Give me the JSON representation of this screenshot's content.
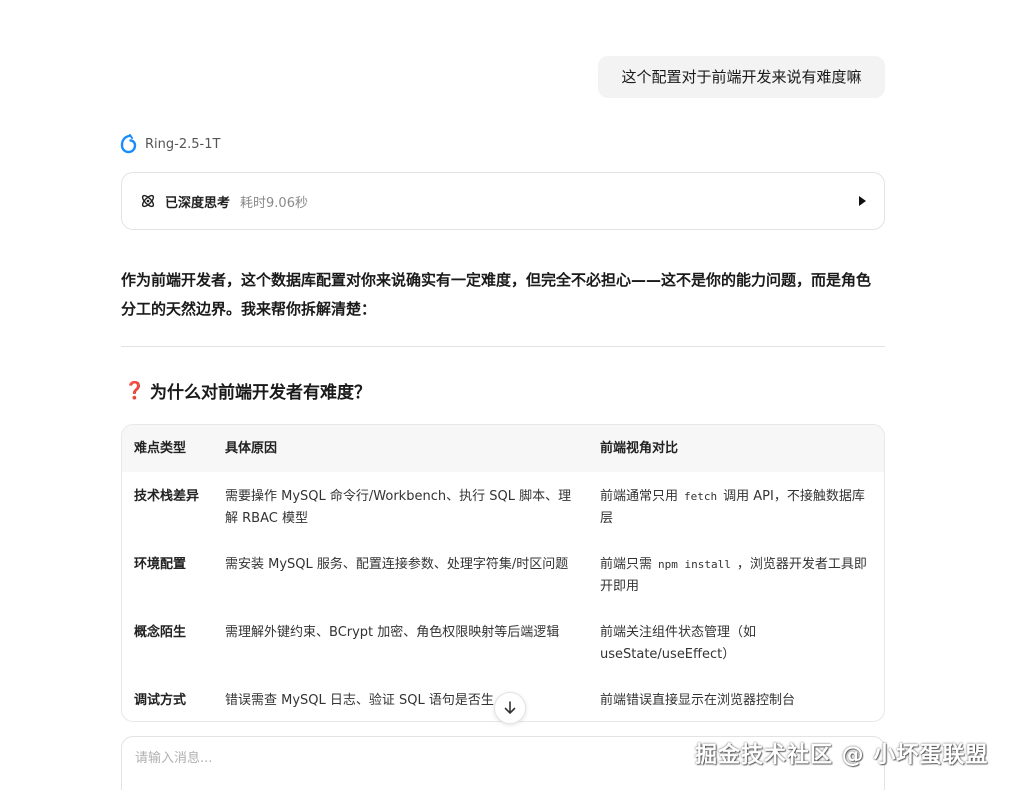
{
  "user_message": "这个配置对于前端开发来说有难度嘛",
  "model": {
    "name": "Ring-2.5-1T",
    "logo_icon": "ring-logo-icon"
  },
  "thinking": {
    "label": "已深度思考",
    "time": "耗时9.06秒"
  },
  "answer": {
    "intro": "作为前端开发者，这个数据库配置对你来说确实有一定难度，但完全不必担心——这不是你的能力问题，而是角色分工的天然边界。我来帮你拆解清楚：",
    "section_title": "为什么对前端开发者有难度？",
    "section_icon": "❓",
    "table": {
      "headers": [
        "难点类型",
        "具体原因",
        "前端视角对比"
      ],
      "rows": [
        {
          "type": "技术栈差异",
          "reason": "需要操作 MySQL 命令行/Workbench、执行 SQL 脚本、理解 RBAC 模型",
          "front_a": "前端通常只用",
          "front_code": "fetch",
          "front_b": "调用 API，不接触数据库层"
        },
        {
          "type": "环境配置",
          "reason": "需安装 MySQL 服务、配置连接参数、处理字符集/时区问题",
          "front_a": "前端只需",
          "front_code": "npm install",
          "front_b": "，浏览器开发者工具即开即用"
        },
        {
          "type": "概念陌生",
          "reason": "需理解外键约束、BCrypt 加密、角色权限映射等后端逻辑",
          "front_a": "前端关注组件状态管理（如 useState/useEffect）",
          "front_code": "",
          "front_b": ""
        },
        {
          "type": "调试方式",
          "reason": "错误需查 MySQL 日志、验证 SQL 语句是否生",
          "front_a": "前端错误直接显示在浏览器控制台",
          "front_code": "",
          "front_b": ""
        }
      ]
    }
  },
  "input": {
    "placeholder": "请输入消息..."
  },
  "watermark": "掘金技术社区 @ 小坏蛋联盟",
  "colors": {
    "accent_blue": "#1a8cff",
    "question_red": "#d9376e"
  }
}
